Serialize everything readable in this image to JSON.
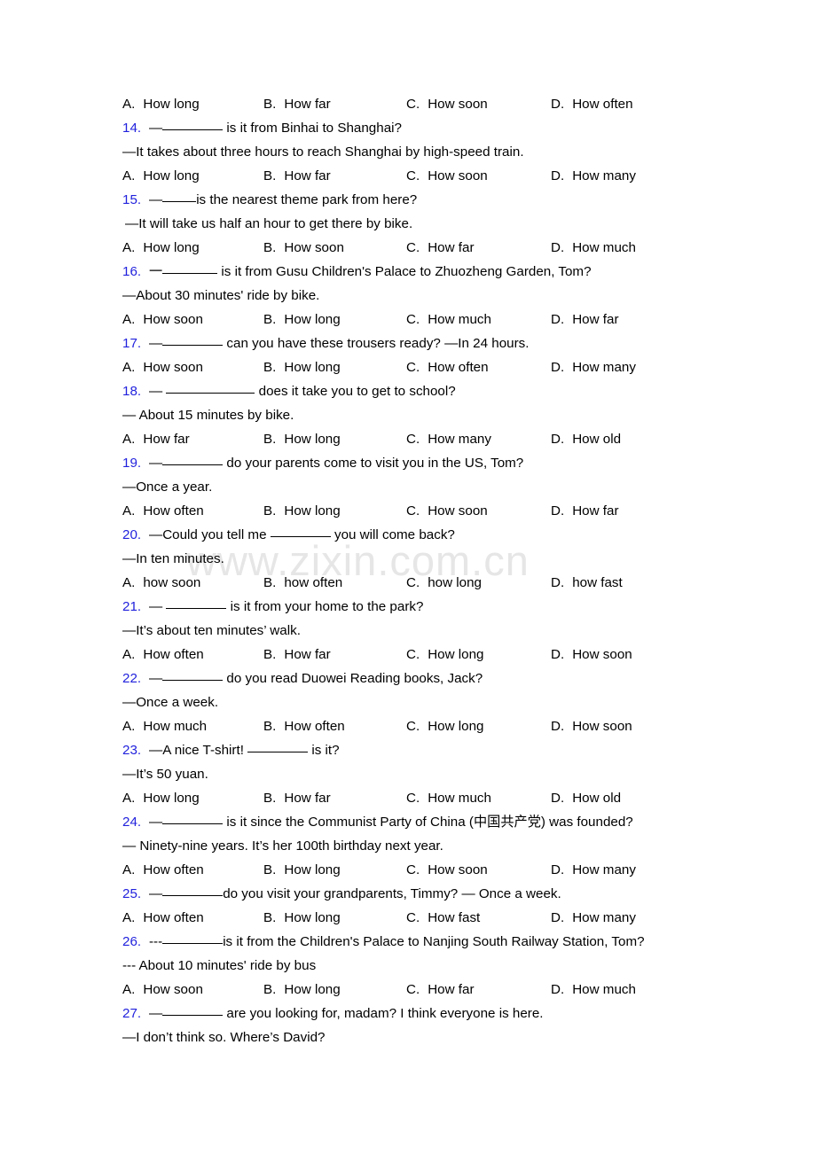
{
  "document": {
    "type": "english-grammar-worksheet",
    "watermark": "www.zixin.com.cn",
    "number_color": "#2222dd",
    "option_labels": [
      "A.",
      "B.",
      "C.",
      "D."
    ]
  },
  "rows": [
    {
      "kind": "options",
      "values": [
        "How long",
        "How far",
        "How soon",
        "How often"
      ]
    },
    {
      "kind": "stem",
      "num": "14.",
      "pre": "—",
      "blank": "m",
      "post": " is it from Binhai to Shanghai?"
    },
    {
      "kind": "text",
      "value": "—It takes about three hours to reach Shanghai by high-speed train."
    },
    {
      "kind": "options",
      "values": [
        "How long",
        "How far",
        "How soon",
        "How many"
      ]
    },
    {
      "kind": "stem",
      "num": "15.",
      "pre": "—",
      "blank": "xs",
      "post": "is the nearest theme park from here?"
    },
    {
      "kind": "text",
      "value": " —It will take us half an hour to get there by bike.",
      "indent": true
    },
    {
      "kind": "options",
      "values": [
        "How long",
        "How soon",
        "How far",
        "How much"
      ]
    },
    {
      "kind": "stem",
      "num": "16.",
      "pre": "一",
      "blank": "s",
      "post": " is it from Gusu Children's Palace to Zhuozheng Garden, Tom?"
    },
    {
      "kind": "text",
      "value": "—About 30 minutes' ride by bike."
    },
    {
      "kind": "options",
      "values": [
        "How soon",
        "How long",
        "How much",
        "How far"
      ]
    },
    {
      "kind": "stem",
      "num": "17.",
      "pre": "—",
      "blank": "m",
      "post": " can you have these trousers ready? —In 24 hours."
    },
    {
      "kind": "options",
      "values": [
        "How soon",
        "How long",
        "How often",
        "How many"
      ]
    },
    {
      "kind": "stem",
      "num": "18.",
      "pre": "— ",
      "blank": "l",
      "post": " does it take you to get to school?"
    },
    {
      "kind": "text",
      "value": "— About 15 minutes by bike."
    },
    {
      "kind": "options",
      "values": [
        "How far",
        "How long",
        "How many",
        "How old"
      ]
    },
    {
      "kind": "stem",
      "num": "19.",
      "pre": "—",
      "blank": "m",
      "post": " do your parents come to visit you in the US, Tom?"
    },
    {
      "kind": "text",
      "value": "—Once a year."
    },
    {
      "kind": "options",
      "values": [
        "How often",
        "How long",
        "How soon",
        "How far"
      ]
    },
    {
      "kind": "stem",
      "num": "20.",
      "pre": "—Could you tell me ",
      "blank": "m",
      "post": " you will come back?"
    },
    {
      "kind": "text",
      "value": "—In ten minutes."
    },
    {
      "kind": "options",
      "values": [
        "how soon",
        "how often",
        "how long",
        "how fast"
      ]
    },
    {
      "kind": "stem",
      "num": "21.",
      "pre": "— ",
      "blank": "m",
      "post": " is it from your home to the park?"
    },
    {
      "kind": "text",
      "value": "—It’s about ten minutes’ walk."
    },
    {
      "kind": "options",
      "values": [
        "How often",
        "How far",
        "How long",
        "How soon"
      ]
    },
    {
      "kind": "stem",
      "num": "22.",
      "pre": "—",
      "blank": "m",
      "post": " do you read Duowei Reading books, Jack?"
    },
    {
      "kind": "text",
      "value": "—Once a week."
    },
    {
      "kind": "options",
      "values": [
        "How much",
        "How often",
        "How long",
        "How soon"
      ]
    },
    {
      "kind": "stem",
      "num": "23.",
      "pre": "—A nice T-shirt! ",
      "blank": "m",
      "post": " is it?"
    },
    {
      "kind": "text",
      "value": "—It’s 50 yuan."
    },
    {
      "kind": "options",
      "values": [
        "How long",
        "How far",
        "How much",
        "How old"
      ]
    },
    {
      "kind": "stem",
      "num": "24.",
      "pre": "—",
      "blank": "m",
      "post": " is it since the Communist Party of China (中国共产党) was founded?"
    },
    {
      "kind": "text",
      "value": "— Ninety-nine years. It’s her 100th birthday next year."
    },
    {
      "kind": "options",
      "values": [
        "How often",
        "How long",
        "How soon",
        "How many"
      ]
    },
    {
      "kind": "stem",
      "num": "25.",
      "pre": "—",
      "blank": "m",
      "post": "do you visit your grandparents, Timmy? — Once a week."
    },
    {
      "kind": "options",
      "values": [
        "How often",
        "How long",
        "How fast",
        "How many"
      ]
    },
    {
      "kind": "stem",
      "num": "26.",
      "pre": "---",
      "blank": "m",
      "post": "is it from the Children's Palace to Nanjing South Railway Station, Tom?"
    },
    {
      "kind": "text",
      "value": "--- About 10 minutes' ride by bus"
    },
    {
      "kind": "options",
      "values": [
        "How soon",
        "How long",
        "How far",
        "How much"
      ]
    },
    {
      "kind": "stem",
      "num": "27.",
      "pre": "—",
      "blank": "m",
      "post": " are you looking for, madam? I think everyone is here."
    },
    {
      "kind": "text",
      "value": "—I don’t think so. Where’s David?"
    }
  ]
}
